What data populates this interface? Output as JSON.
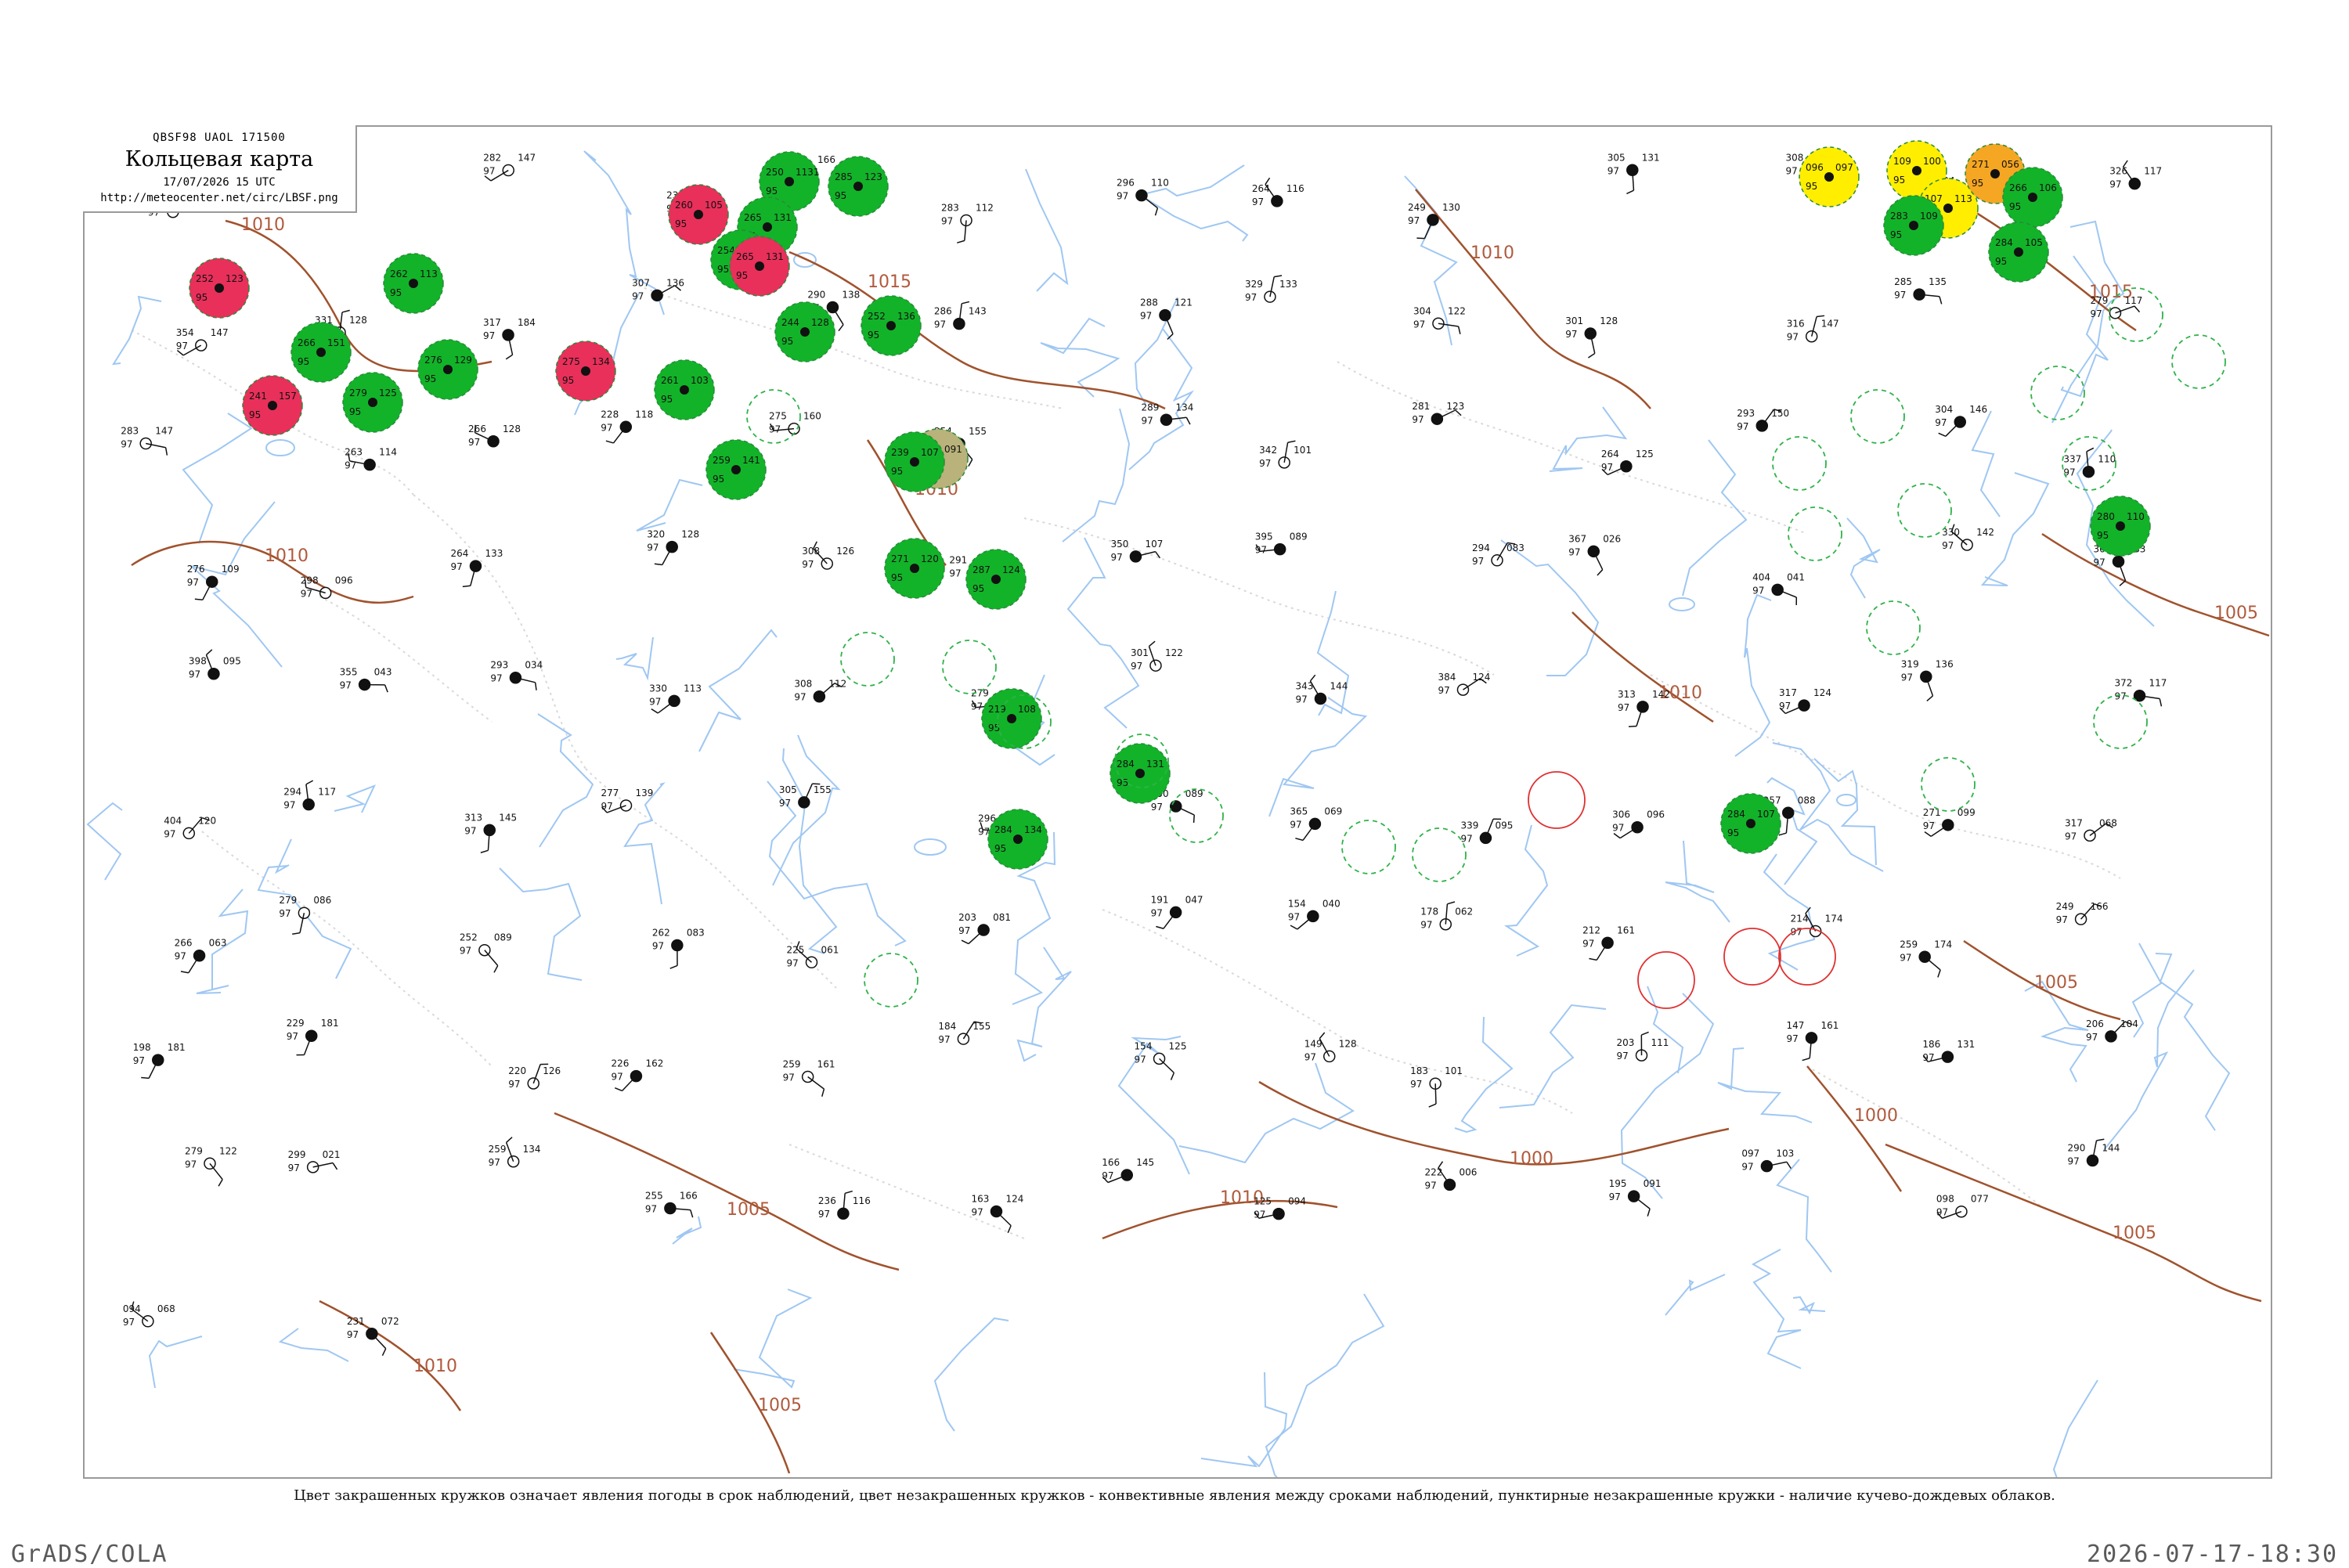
{
  "header": {
    "code_line": "QBSF98  UAOL  171500",
    "title": "Кольцевая карта",
    "datetime": "17/07/2026 15 UTC",
    "url": "http://meteocenter.net/circ/LBSF.png"
  },
  "legend_text": "Цвет закрашенных кружков означает явления погоды в срок наблюдений, цвет незакрашенных кружков - конвективные явления между сроками наблюдений, пунктирные незакрашенные кружки - наличие кучево-дождевых облаков.",
  "footer": {
    "left": "GrADS/COLA",
    "right": "2026-07-17-18:30"
  },
  "isobars": [
    "1010",
    "1015",
    "1010",
    "1015",
    "1000",
    "1005",
    "1010",
    "1005",
    "1010",
    "1005",
    "1000",
    "1005",
    "1010",
    "1010",
    "1005",
    "1010"
  ],
  "colors": {
    "frame": "#9a9a9a",
    "river": "#9fc7f2",
    "border": "#d9d9d9",
    "isobar": "#a0522d",
    "isobar_label": "#b05a3c",
    "thunder_green": "#12b329",
    "hail_red": "#e8305a",
    "yellow": "#ffee00",
    "orange": "#f5a623",
    "olive": "#b9b27a",
    "cb_dashed": "#2fb24a",
    "convective_red": "#e03030"
  },
  "stations": [
    {
      "t": "257",
      "p": "110",
      "d": "97",
      "kind": "plain"
    },
    {
      "t": "281",
      "p": "147",
      "d": "97",
      "kind": "plain"
    },
    {
      "t": "282",
      "p": "147",
      "d": "97",
      "kind": "plain"
    },
    {
      "t": "235",
      "p": "005",
      "d": "97",
      "kind": "plain"
    },
    {
      "t": "248",
      "p": "166",
      "d": "97",
      "kind": "plain"
    },
    {
      "t": "283",
      "p": "112",
      "d": "97",
      "kind": "plain"
    },
    {
      "t": "296",
      "p": "110",
      "d": "97",
      "kind": "plain"
    },
    {
      "t": "264",
      "p": "116",
      "d": "97",
      "kind": "plain"
    },
    {
      "t": "249",
      "p": "130",
      "d": "97",
      "kind": "plain"
    },
    {
      "t": "305",
      "p": "131",
      "d": "97",
      "kind": "plain"
    },
    {
      "t": "308",
      "p": "101",
      "d": "97",
      "kind": "plain"
    },
    {
      "t": "297",
      "p": "124",
      "d": "97",
      "kind": "plain"
    },
    {
      "t": "326",
      "p": "117",
      "d": "97",
      "kind": "plain"
    },
    {
      "t": "354",
      "p": "147",
      "d": "97",
      "kind": "plain"
    },
    {
      "t": "331",
      "p": "128",
      "d": "97",
      "kind": "plain"
    },
    {
      "t": "317",
      "p": "184",
      "d": "97",
      "kind": "plain"
    },
    {
      "t": "307",
      "p": "136",
      "d": "97",
      "kind": "plain"
    },
    {
      "t": "290",
      "p": "138",
      "d": "97",
      "kind": "plain"
    },
    {
      "t": "286",
      "p": "143",
      "d": "97",
      "kind": "plain"
    },
    {
      "t": "288",
      "p": "121",
      "d": "97",
      "kind": "plain"
    },
    {
      "t": "329",
      "p": "133",
      "d": "97",
      "kind": "plain"
    },
    {
      "t": "304",
      "p": "122",
      "d": "97",
      "kind": "plain"
    },
    {
      "t": "301",
      "p": "128",
      "d": "97",
      "kind": "plain"
    },
    {
      "t": "316",
      "p": "147",
      "d": "97",
      "kind": "plain"
    },
    {
      "t": "285",
      "p": "135",
      "d": "97",
      "kind": "plain"
    },
    {
      "t": "279",
      "p": "117",
      "d": "97",
      "kind": "plain"
    },
    {
      "t": "283",
      "p": "147",
      "d": "97",
      "kind": "plain"
    },
    {
      "t": "263",
      "p": "114",
      "d": "97",
      "kind": "plain"
    },
    {
      "t": "266",
      "p": "128",
      "d": "97",
      "kind": "plain"
    },
    {
      "t": "228",
      "p": "118",
      "d": "97",
      "kind": "plain"
    },
    {
      "t": "275",
      "p": "160",
      "d": "97",
      "kind": "plain"
    },
    {
      "t": "254",
      "p": "155",
      "d": "97",
      "kind": "plain"
    },
    {
      "t": "289",
      "p": "134",
      "d": "97",
      "kind": "plain"
    },
    {
      "t": "342",
      "p": "101",
      "d": "97",
      "kind": "plain"
    },
    {
      "t": "281",
      "p": "123",
      "d": "97",
      "kind": "plain"
    },
    {
      "t": "264",
      "p": "125",
      "d": "97",
      "kind": "plain"
    },
    {
      "t": "293",
      "p": "150",
      "d": "97",
      "kind": "plain"
    },
    {
      "t": "304",
      "p": "146",
      "d": "97",
      "kind": "plain"
    },
    {
      "t": "337",
      "p": "110",
      "d": "97",
      "kind": "plain"
    },
    {
      "t": "276",
      "p": "109",
      "d": "97",
      "kind": "plain"
    },
    {
      "t": "298",
      "p": "096",
      "d": "97",
      "kind": "plain"
    },
    {
      "t": "264",
      "p": "133",
      "d": "97",
      "kind": "plain"
    },
    {
      "t": "320",
      "p": "128",
      "d": "97",
      "kind": "plain"
    },
    {
      "t": "308",
      "p": "126",
      "d": "97",
      "kind": "plain"
    },
    {
      "t": "291",
      "p": "126",
      "d": "97",
      "kind": "plain"
    },
    {
      "t": "350",
      "p": "107",
      "d": "97",
      "kind": "plain"
    },
    {
      "t": "395",
      "p": "089",
      "d": "97",
      "kind": "plain"
    },
    {
      "t": "294",
      "p": "083",
      "d": "97",
      "kind": "plain"
    },
    {
      "t": "367",
      "p": "026",
      "d": "97",
      "kind": "plain"
    },
    {
      "t": "404",
      "p": "041",
      "d": "97",
      "kind": "plain"
    },
    {
      "t": "330",
      "p": "142",
      "d": "97",
      "kind": "plain"
    },
    {
      "t": "363",
      "p": "083",
      "d": "97",
      "kind": "plain"
    },
    {
      "t": "398",
      "p": "095",
      "d": "97",
      "kind": "plain"
    },
    {
      "t": "355",
      "p": "043",
      "d": "97",
      "kind": "plain"
    },
    {
      "t": "293",
      "p": "034",
      "d": "97",
      "kind": "plain"
    },
    {
      "t": "330",
      "p": "113",
      "d": "97",
      "kind": "plain"
    },
    {
      "t": "308",
      "p": "112",
      "d": "97",
      "kind": "plain"
    },
    {
      "t": "279",
      "p": "098",
      "d": "97",
      "kind": "plain"
    },
    {
      "t": "301",
      "p": "122",
      "d": "97",
      "kind": "plain"
    },
    {
      "t": "343",
      "p": "144",
      "d": "97",
      "kind": "plain"
    },
    {
      "t": "384",
      "p": "124",
      "d": "97",
      "kind": "plain"
    },
    {
      "t": "313",
      "p": "142",
      "d": "97",
      "kind": "plain"
    },
    {
      "t": "317",
      "p": "124",
      "d": "97",
      "kind": "plain"
    },
    {
      "t": "319",
      "p": "136",
      "d": "97",
      "kind": "plain"
    },
    {
      "t": "372",
      "p": "117",
      "d": "97",
      "kind": "plain"
    },
    {
      "t": "404",
      "p": "120",
      "d": "97",
      "kind": "plain"
    },
    {
      "t": "294",
      "p": "117",
      "d": "97",
      "kind": "plain"
    },
    {
      "t": "313",
      "p": "145",
      "d": "97",
      "kind": "plain"
    },
    {
      "t": "277",
      "p": "139",
      "d": "97",
      "kind": "plain"
    },
    {
      "t": "305",
      "p": "155",
      "d": "97",
      "kind": "plain"
    },
    {
      "t": "296",
      "p": "103",
      "d": "97",
      "kind": "plain"
    },
    {
      "t": "350",
      "p": "089",
      "d": "97",
      "kind": "plain"
    },
    {
      "t": "365",
      "p": "069",
      "d": "97",
      "kind": "plain"
    },
    {
      "t": "339",
      "p": "095",
      "d": "97",
      "kind": "plain"
    },
    {
      "t": "306",
      "p": "096",
      "d": "97",
      "kind": "plain"
    },
    {
      "t": "257",
      "p": "088",
      "d": "97",
      "kind": "plain"
    },
    {
      "t": "271",
      "p": "099",
      "d": "97",
      "kind": "plain"
    },
    {
      "t": "317",
      "p": "068",
      "d": "97",
      "kind": "plain"
    },
    {
      "t": "266",
      "p": "063",
      "d": "97",
      "kind": "plain"
    },
    {
      "t": "279",
      "p": "086",
      "d": "97",
      "kind": "plain"
    },
    {
      "t": "252",
      "p": "089",
      "d": "97",
      "kind": "plain"
    },
    {
      "t": "262",
      "p": "083",
      "d": "97",
      "kind": "plain"
    },
    {
      "t": "225",
      "p": "061",
      "d": "97",
      "kind": "plain"
    },
    {
      "t": "203",
      "p": "081",
      "d": "97",
      "kind": "plain"
    },
    {
      "t": "191",
      "p": "047",
      "d": "97",
      "kind": "plain"
    },
    {
      "t": "154",
      "p": "040",
      "d": "97",
      "kind": "plain"
    },
    {
      "t": "178",
      "p": "062",
      "d": "97",
      "kind": "plain"
    },
    {
      "t": "212",
      "p": "161",
      "d": "97",
      "kind": "plain"
    },
    {
      "t": "214",
      "p": "174",
      "d": "97",
      "kind": "plain"
    },
    {
      "t": "259",
      "p": "174",
      "d": "97",
      "kind": "plain"
    },
    {
      "t": "249",
      "p": "166",
      "d": "97",
      "kind": "plain"
    },
    {
      "t": "198",
      "p": "181",
      "d": "97",
      "kind": "plain"
    },
    {
      "t": "229",
      "p": "181",
      "d": "97",
      "kind": "plain"
    },
    {
      "t": "220",
      "p": "126",
      "d": "97",
      "kind": "plain"
    },
    {
      "t": "226",
      "p": "162",
      "d": "97",
      "kind": "plain"
    },
    {
      "t": "259",
      "p": "161",
      "d": "97",
      "kind": "plain"
    },
    {
      "t": "184",
      "p": "155",
      "d": "97",
      "kind": "plain"
    },
    {
      "t": "154",
      "p": "125",
      "d": "97",
      "kind": "plain"
    },
    {
      "t": "149",
      "p": "128",
      "d": "97",
      "kind": "plain"
    },
    {
      "t": "183",
      "p": "101",
      "d": "97",
      "kind": "plain"
    },
    {
      "t": "203",
      "p": "111",
      "d": "97",
      "kind": "plain"
    },
    {
      "t": "147",
      "p": "161",
      "d": "97",
      "kind": "plain"
    },
    {
      "t": "186",
      "p": "131",
      "d": "97",
      "kind": "plain"
    },
    {
      "t": "206",
      "p": "104",
      "d": "97",
      "kind": "plain"
    },
    {
      "t": "279",
      "p": "122",
      "d": "97",
      "kind": "plain"
    },
    {
      "t": "299",
      "p": "021",
      "d": "97",
      "kind": "plain"
    },
    {
      "t": "259",
      "p": "134",
      "d": "97",
      "kind": "plain"
    },
    {
      "t": "255",
      "p": "166",
      "d": "97",
      "kind": "plain"
    },
    {
      "t": "236",
      "p": "116",
      "d": "97",
      "kind": "plain"
    },
    {
      "t": "163",
      "p": "124",
      "d": "97",
      "kind": "plain"
    },
    {
      "t": "166",
      "p": "145",
      "d": "97",
      "kind": "plain"
    },
    {
      "t": "125",
      "p": "094",
      "d": "97",
      "kind": "plain"
    },
    {
      "t": "222",
      "p": "006",
      "d": "97",
      "kind": "plain"
    },
    {
      "t": "195",
      "p": "091",
      "d": "97",
      "kind": "plain"
    },
    {
      "t": "097",
      "p": "103",
      "d": "97",
      "kind": "plain"
    },
    {
      "t": "098",
      "p": "077",
      "d": "97",
      "kind": "plain"
    },
    {
      "t": "290",
      "p": "144",
      "d": "97",
      "kind": "plain"
    },
    {
      "t": "094",
      "p": "068",
      "d": "97",
      "kind": "plain"
    },
    {
      "t": "231",
      "p": "072",
      "d": "97",
      "kind": "plain"
    }
  ],
  "weather_circles": [
    {
      "t": "252",
      "p": "123",
      "d": "95",
      "kind": "hail_red"
    },
    {
      "t": "250",
      "p": "1131",
      "d": "95",
      "kind": "thunder_green"
    },
    {
      "t": "285",
      "p": "123",
      "d": "95",
      "kind": "thunder_green"
    },
    {
      "t": "265",
      "p": "131",
      "d": "95",
      "kind": "thunder_green"
    },
    {
      "t": "254",
      "p": "135",
      "d": "95",
      "kind": "thunder_green"
    },
    {
      "t": "252",
      "p": "136",
      "d": "95",
      "kind": "thunder_green"
    },
    {
      "t": "244",
      "p": "128",
      "d": "95",
      "kind": "thunder_green"
    },
    {
      "t": "260",
      "p": "105",
      "d": "95",
      "kind": "hail_red"
    },
    {
      "t": "265",
      "p": "131",
      "d": "95",
      "kind": "hail_red"
    },
    {
      "t": "275",
      "p": "134",
      "d": "95",
      "kind": "hail_red"
    },
    {
      "t": "261",
      "p": "103",
      "d": "95",
      "kind": "thunder_green"
    },
    {
      "t": "262",
      "p": "113",
      "d": "95",
      "kind": "thunder_green"
    },
    {
      "t": "266",
      "p": "151",
      "d": "95",
      "kind": "thunder_green"
    },
    {
      "t": "276",
      "p": "129",
      "d": "95",
      "kind": "thunder_green"
    },
    {
      "t": "279",
      "p": "125",
      "d": "95",
      "kind": "thunder_green"
    },
    {
      "t": "241",
      "p": "157",
      "d": "95",
      "kind": "hail_red"
    },
    {
      "t": "259",
      "p": "141",
      "d": "95",
      "kind": "thunder_green"
    },
    {
      "t": "271",
      "p": "120",
      "d": "95",
      "kind": "thunder_green"
    },
    {
      "t": "284",
      "p": "134",
      "d": "95",
      "kind": "thunder_green"
    },
    {
      "t": "284",
      "p": "131",
      "d": "95",
      "kind": "thunder_green"
    },
    {
      "t": "287",
      "p": "124",
      "d": "95",
      "kind": "thunder_green"
    },
    {
      "t": "293",
      "p": "091",
      "d": "95",
      "kind": "olive"
    },
    {
      "t": "096",
      "p": "097",
      "d": "95",
      "kind": "yellow"
    },
    {
      "t": "109",
      "p": "100",
      "d": "95",
      "kind": "yellow"
    },
    {
      "t": "107",
      "p": "113",
      "d": "95",
      "kind": "yellow"
    },
    {
      "t": "271",
      "p": "056",
      "d": "95",
      "kind": "orange"
    },
    {
      "t": "266",
      "p": "106",
      "d": "95",
      "kind": "thunder_green"
    },
    {
      "t": "284",
      "p": "105",
      "d": "95",
      "kind": "thunder_green"
    },
    {
      "t": "283",
      "p": "109",
      "d": "95",
      "kind": "thunder_green"
    },
    {
      "t": "284",
      "p": "107",
      "d": "95",
      "kind": "thunder_green"
    },
    {
      "t": "280",
      "p": "110",
      "d": "95",
      "kind": "thunder_green"
    },
    {
      "t": "239",
      "p": "107",
      "d": "95",
      "kind": "thunder_green"
    },
    {
      "t": "219",
      "p": "108",
      "d": "95",
      "kind": "thunder_green"
    }
  ]
}
